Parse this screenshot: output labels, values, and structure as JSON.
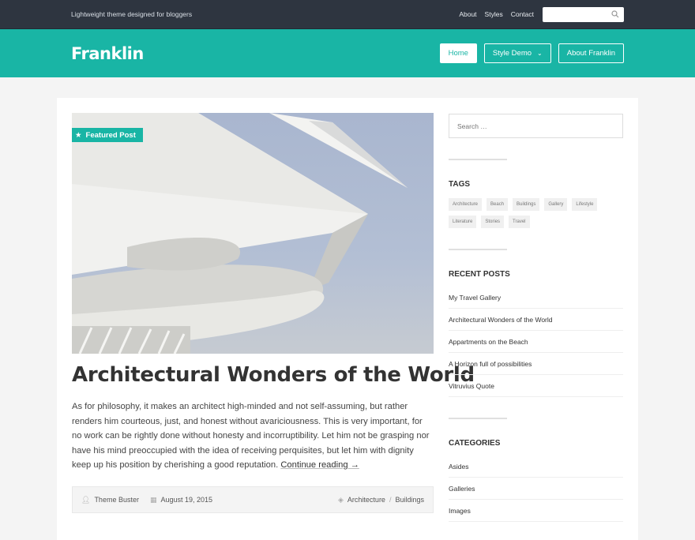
{
  "topbar": {
    "tagline": "Lightweight theme designed for bloggers",
    "nav": [
      "About",
      "Styles",
      "Contact"
    ],
    "search_placeholder": ""
  },
  "header": {
    "logo": "Franklin",
    "nav": [
      {
        "label": "Home"
      },
      {
        "label": "Style Demo"
      },
      {
        "label": "About Franklin"
      }
    ]
  },
  "post": {
    "badge": "Featured Post",
    "title": "Architectural Wonders of the World",
    "excerpt": "As for philosophy, it makes an architect high-minded and not self-assuming, but rather renders him courteous, just, and honest without avariciousness. This is very important, for no work can be rightly done without honesty and incorruptibility. Let him not be grasping nor have his mind preoccupied with the idea of receiving perquisites, but let him with dignity keep up his position by cherishing a good reputation.",
    "read_more": "Continue reading →",
    "author": "Theme Buster",
    "date": "August 19, 2015",
    "categories": [
      "Architecture",
      "Buildings"
    ],
    "category_sep": "/"
  },
  "sidebar": {
    "search_placeholder": "Search …",
    "tags_title": "TAGS",
    "tags": [
      "Architecture",
      "Beach",
      "Buildings",
      "Gallery",
      "Lifestyle",
      "Literature",
      "Stories",
      "Travel"
    ],
    "recent_title": "RECENT POSTS",
    "recent": [
      "My Travel Gallery",
      "Architectural Wonders of the World",
      "Appartments on the Beach",
      "A Horizon full of possibilities",
      "Vitruvius Quote"
    ],
    "categories_title": "CATEGORIES",
    "categories": [
      "Asides",
      "Galleries",
      "Images"
    ]
  },
  "colors": {
    "accent": "#19b5a5",
    "topbar": "#2e3540"
  }
}
